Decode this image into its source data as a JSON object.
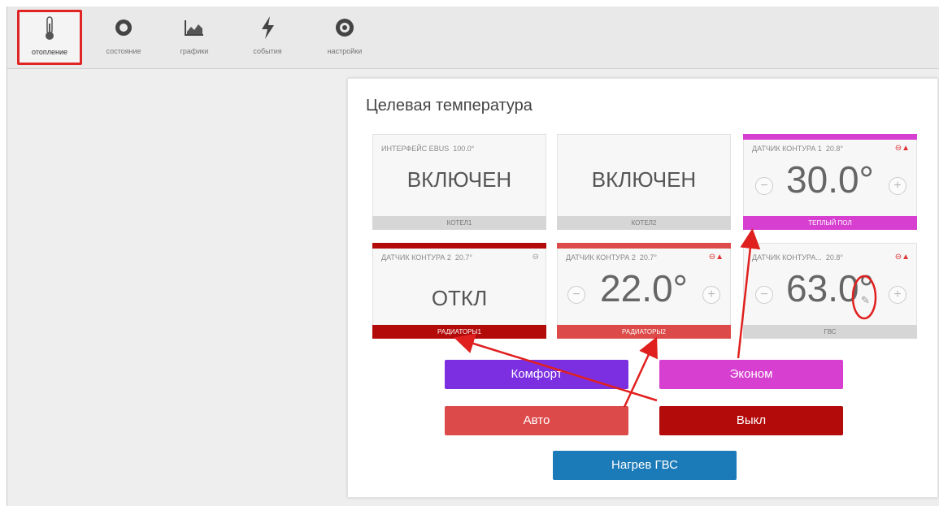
{
  "toolbar": {
    "items": [
      {
        "label": "отопление",
        "icon": "thermometer-icon"
      },
      {
        "label": "состояние",
        "icon": "circle-icon"
      },
      {
        "label": "графики",
        "icon": "chart-icon"
      },
      {
        "label": "события",
        "icon": "lightning-icon"
      },
      {
        "label": "настройки",
        "icon": "gear-icon"
      }
    ]
  },
  "panel": {
    "title": "Целевая температура",
    "cards": [
      {
        "header": "ИНТЕРФЕЙС EBUS",
        "header_value": "100.0°",
        "value": "ВКЛЮЧЕН",
        "footer": "КОТЕЛ1"
      },
      {
        "header": "",
        "header_value": "",
        "value": "ВКЛЮЧЕН",
        "footer": "КОТЕЛ2"
      },
      {
        "header": "ДАТЧИК КОНТУРА 1",
        "header_value": "20.8°",
        "value": "30.0°",
        "footer": "ТЕПЛЫЙ ПОЛ",
        "color": "#d63fd0"
      },
      {
        "header": "ДАТЧИК КОНТУРА 2",
        "header_value": "20.7°",
        "value": "ОТКЛ",
        "footer": "РАДИАТОРЫ1",
        "color": "#b30a0a"
      },
      {
        "header": "ДАТЧИК КОНТУРА 2",
        "header_value": "20.7°",
        "value": "22.0°",
        "footer": "РАДИАТОРЫ2",
        "color": "#dc4a4a"
      },
      {
        "header": "ДАТЧИК КОНТУРА...",
        "header_value": "20.8°",
        "value": "63.0°",
        "footer": "ГВС"
      }
    ],
    "modes": [
      {
        "label": "Комфорт",
        "color": "#7b2fe0"
      },
      {
        "label": "Эконом",
        "color": "#d63fd0"
      },
      {
        "label": "Авто",
        "color": "#dc4a4a"
      },
      {
        "label": "Выкл",
        "color": "#b30a0a"
      },
      {
        "label": "Нагрев ГВС",
        "color": "#1b7ab8"
      }
    ]
  }
}
